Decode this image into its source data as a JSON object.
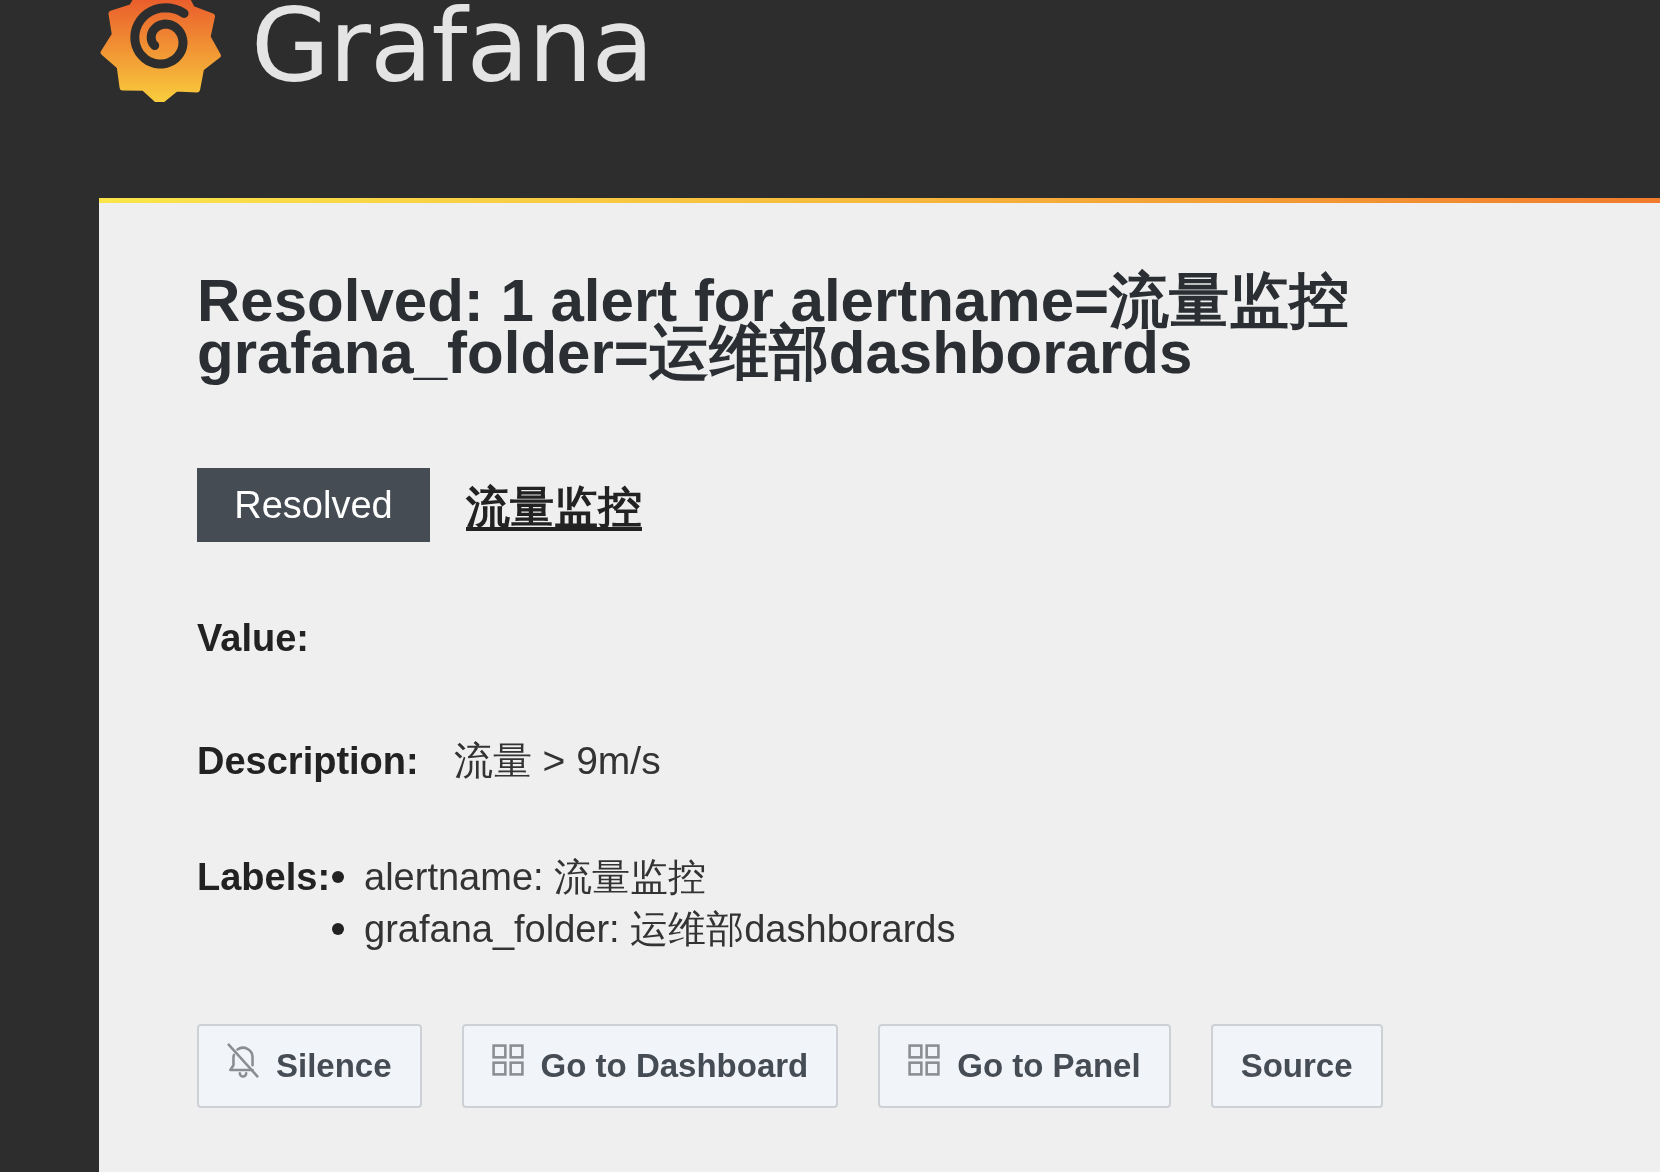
{
  "header": {
    "logo_text": "Grafana"
  },
  "alert": {
    "title": "Resolved: 1 alert for alertname=流量监控 grafana_folder=运维部dashborards",
    "status": {
      "label": "Resolved",
      "kind": "resolved"
    },
    "rule_link": "流量监控"
  },
  "fields": [
    {
      "kind": "text",
      "label": "Value:"
    },
    {
      "kind": "text",
      "label": "Description:",
      "value": "流量 > 9m/s"
    },
    {
      "kind": "list",
      "label": "Labels:",
      "items": [
        "alertname: 流量监控",
        "grafana_folder: 运维部dashborards"
      ]
    }
  ],
  "buttons": [
    {
      "kind": "silence",
      "label": "Silence"
    },
    {
      "kind": "link",
      "label": "Go to Dashboard"
    },
    {
      "kind": "link",
      "label": "Go to Panel"
    },
    {
      "kind": "plain",
      "label": "Source"
    }
  ]
}
